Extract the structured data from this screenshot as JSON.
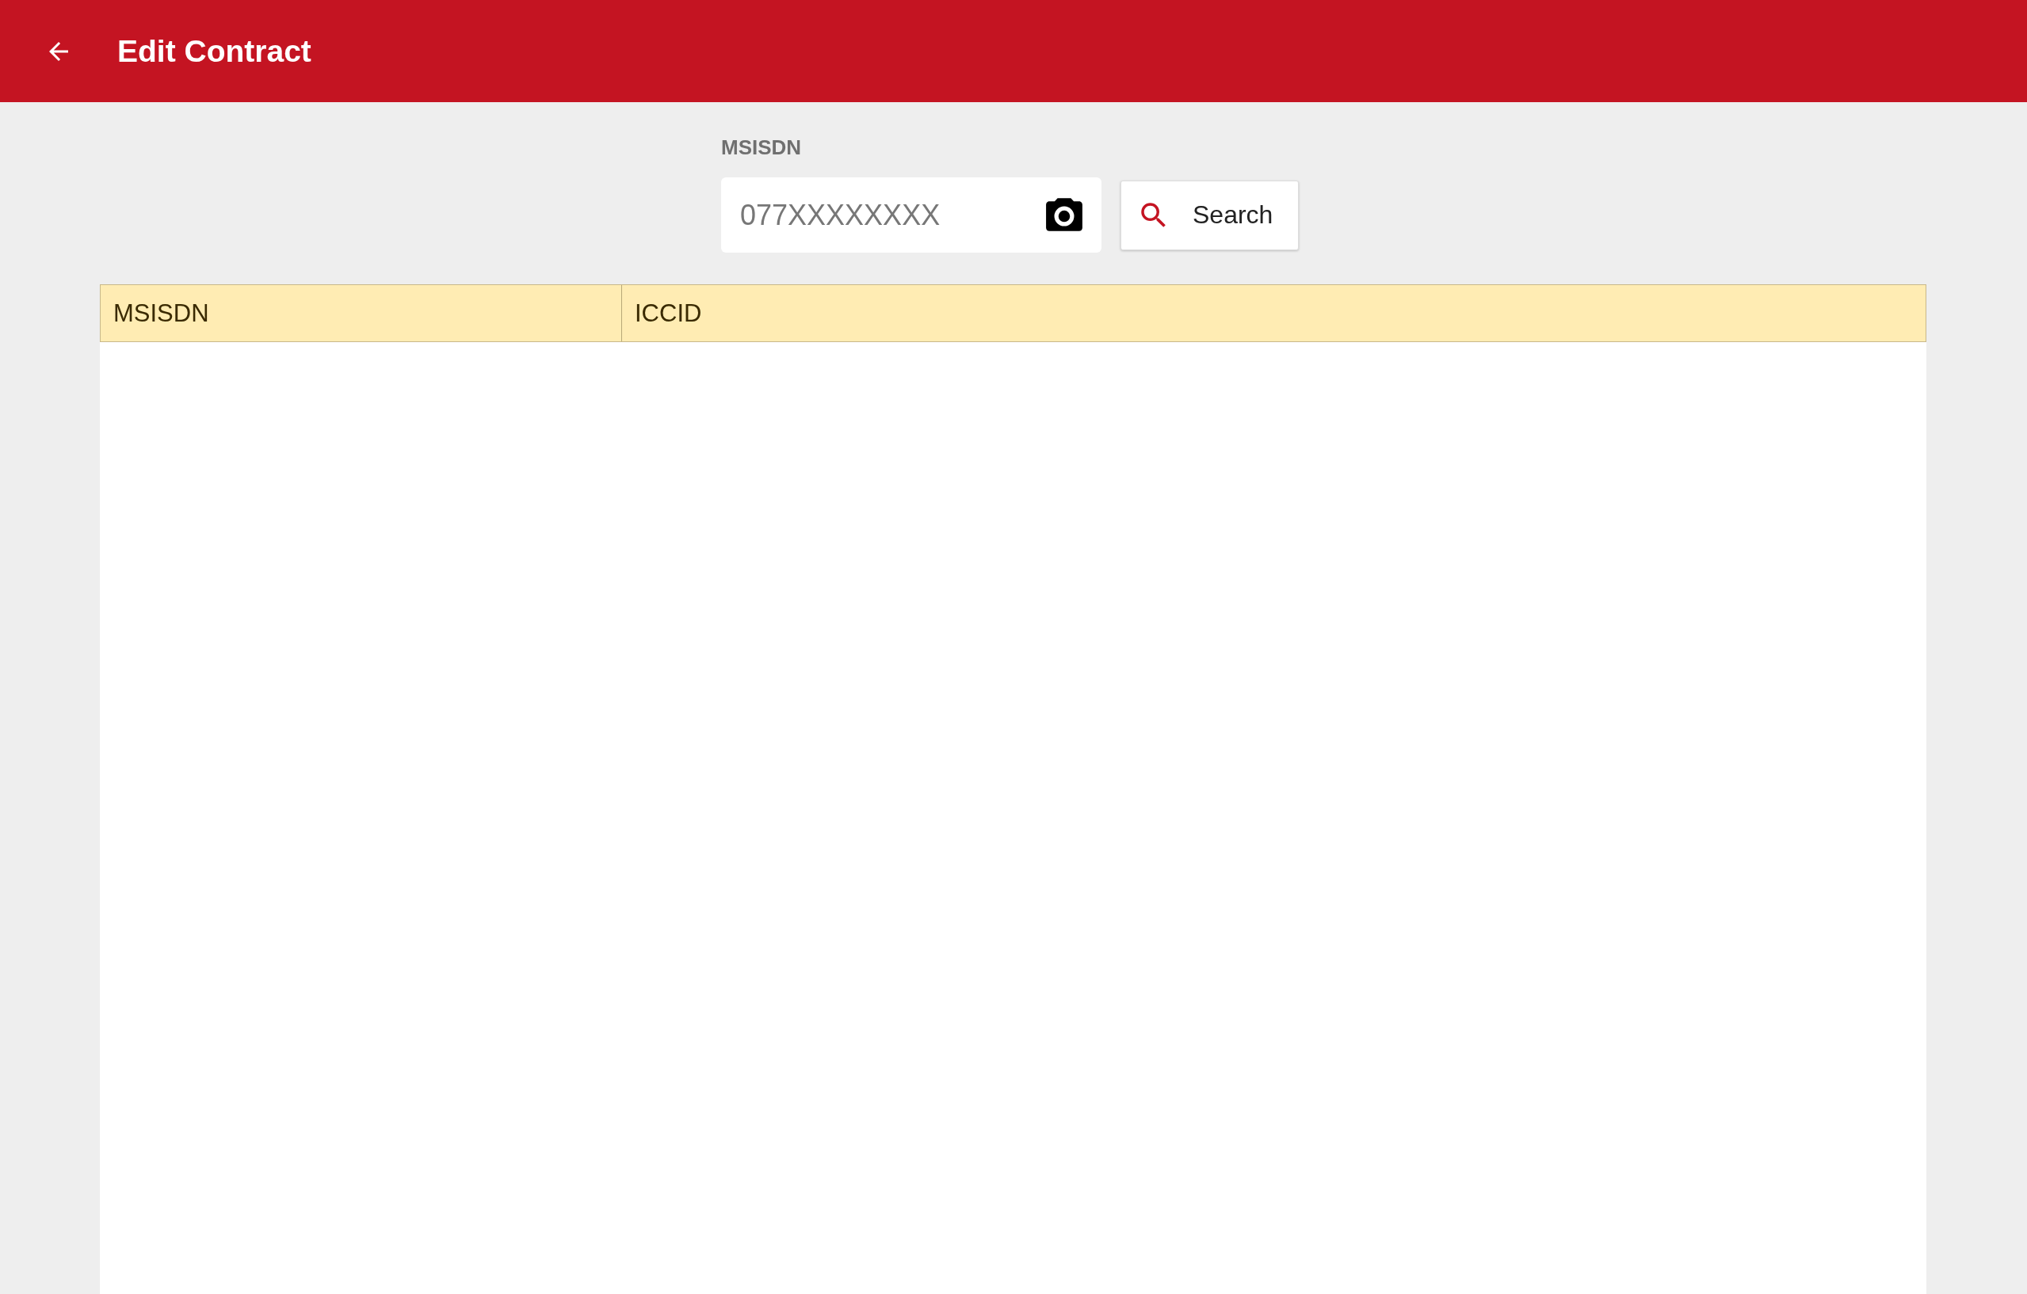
{
  "app_bar": {
    "title": "Edit Contract"
  },
  "search": {
    "label": "MSISDN",
    "placeholder": "077XXXXXXXX",
    "button": "Search"
  },
  "table": {
    "columns": [
      "MSISDN",
      "ICCID"
    ]
  }
}
